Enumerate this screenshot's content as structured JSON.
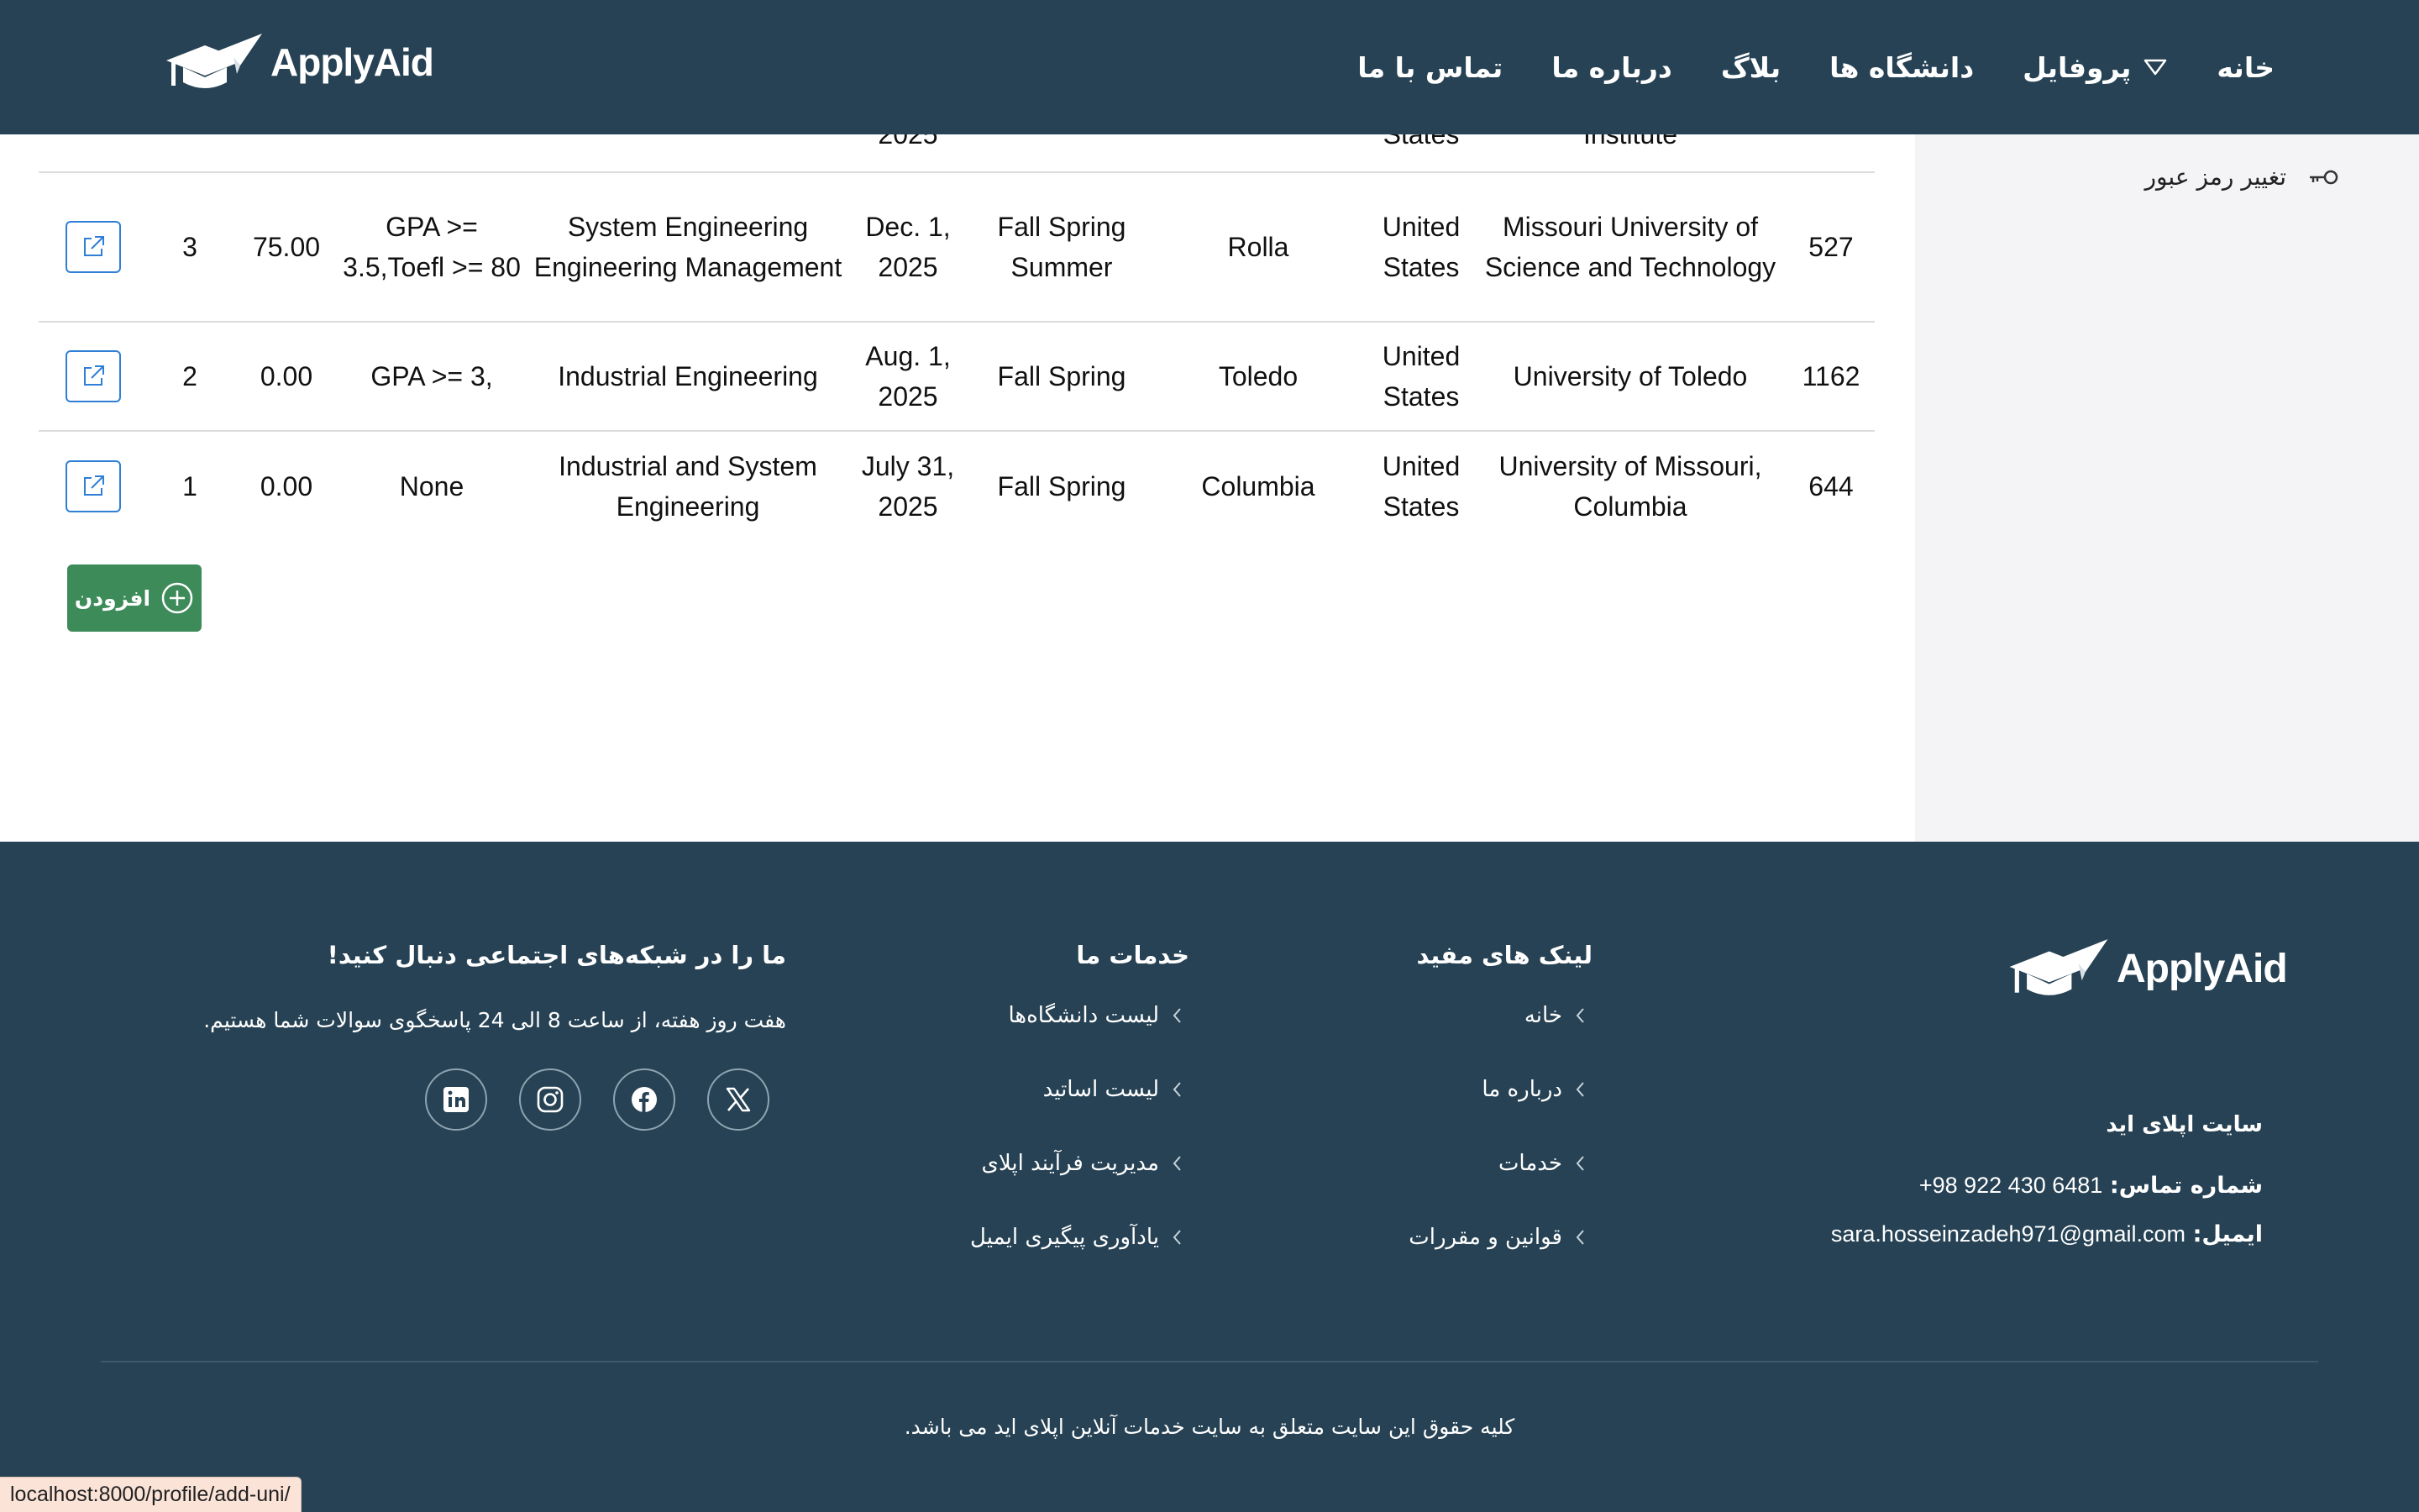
{
  "header": {
    "logo_text": "ApplyAid",
    "nav": [
      "خانه",
      "پروفایل",
      "دانشگاه ها",
      "بلاگ",
      "درباره ما",
      "تماس با ما"
    ]
  },
  "sidebar": {
    "change_password": "تغییر رمز عبور"
  },
  "table": {
    "partial_row": {
      "id": "",
      "university": "Institute",
      "country": "States",
      "city": "",
      "semesters": "",
      "deadline": "2025",
      "program": "",
      "requirements": "",
      "fee": "",
      "priority": ""
    },
    "rows": [
      {
        "id": "527",
        "university": "Missouri University of Science and Technology",
        "country": "United States",
        "city": "Rolla",
        "semesters": "Fall Spring Summer",
        "deadline": "Dec. 1, 2025",
        "program": "System Engineering Engineering Management",
        "requirements": "GPA >= 3.5,Toefl >= 80",
        "fee": "75.00",
        "priority": "3"
      },
      {
        "id": "1162",
        "university": "University of Toledo",
        "country": "United States",
        "city": "Toledo",
        "semesters": "Fall Spring",
        "deadline": "Aug. 1, 2025",
        "program": "Industrial Engineering",
        "requirements": "GPA >= 3,",
        "fee": "0.00",
        "priority": "2"
      },
      {
        "id": "644",
        "university": "University of Missouri, Columbia",
        "country": "United States",
        "city": "Columbia",
        "semesters": "Fall Spring",
        "deadline": "July 31, 2025",
        "program": "Industrial and System Engineering",
        "requirements": "None",
        "fee": "0.00",
        "priority": "1"
      }
    ],
    "add_label": "افزودن"
  },
  "footer": {
    "logo_text": "ApplyAid",
    "site_name": "سایت اپلای اید",
    "phone_label": "شماره تماس:",
    "phone": "+98 922 430 6481",
    "email_label": "ایمیل:",
    "email": "sara.hosseinzadeh971@gmail.com",
    "useful_links": {
      "title": "لینک های مفید",
      "items": [
        "خانه",
        "درباره ما",
        "خدمات",
        "قوانین و مقررات"
      ]
    },
    "services": {
      "title": "خدمات ما",
      "items": [
        "لیست دانشگاه‌ها",
        "لیست اساتید",
        "مدیریت فرآیند اپلای",
        "یادآوری پیگیری ایمیل"
      ]
    },
    "social": {
      "title": "ما را در شبکه‌های اجتماعی دنبال کنید!",
      "subtitle": "هفت روز هفته، از ساعت 8 الی 24 پاسخگوی سوالات شما هستیم.",
      "icons": [
        "linkedin-icon",
        "instagram-icon",
        "facebook-icon",
        "x-icon"
      ]
    },
    "copyright": "کلیه حقوق این سایت متعلق به سایت خدمات آنلاین اپلای اید می باشد."
  },
  "status_url": "localhost:8000/profile/add-uni/",
  "colors": {
    "navy": "#264254",
    "button_green": "#3e8b5a",
    "edit_blue": "#2f7fd6",
    "sidebar_bg": "#f4f4f6"
  }
}
